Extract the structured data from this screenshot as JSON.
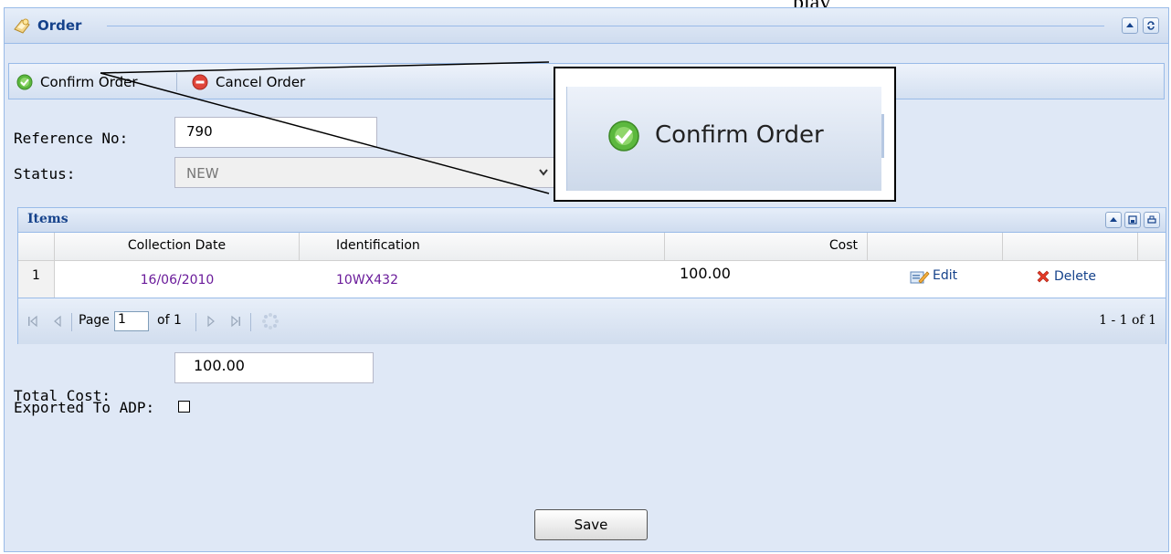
{
  "top_clip_text": "play",
  "panel": {
    "title": "Order"
  },
  "toolbar": {
    "confirm_label": "Confirm Order",
    "cancel_label": "Cancel Order"
  },
  "form": {
    "reference_label": "Reference No:",
    "reference_value": "790",
    "status_label": "Status:",
    "status_value": "NEW",
    "total_label": "Total Cost:",
    "total_value": "100.00",
    "exported_label": "Exported To ADP:",
    "exported_checked": false
  },
  "zoom_callout": {
    "label": "Confirm Order"
  },
  "items_grid": {
    "title": "Items",
    "columns": [
      "Collection Date",
      "Identification",
      "Cost"
    ],
    "rows": [
      {
        "num": "1",
        "date": "16/06/2010",
        "identification": "10WX432",
        "cost": "100.00",
        "edit": "Edit",
        "delete": "Delete"
      }
    ],
    "pager": {
      "page_label": "Page",
      "page_value": "1",
      "of_label": "of 1",
      "summary": "1 - 1 of 1"
    }
  },
  "save_label": "Save",
  "colors": {
    "header_text": "#15428b",
    "panel_bg": "#dfe8f6",
    "border": "#99bbe8",
    "link_purple": "#6a1b9a"
  }
}
